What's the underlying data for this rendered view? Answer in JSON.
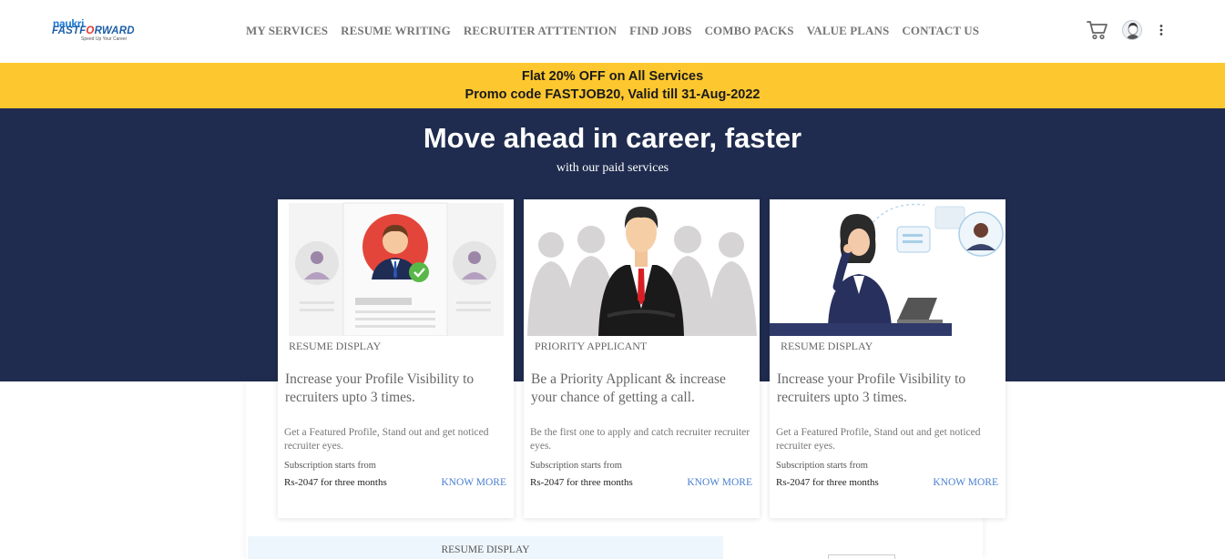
{
  "header": {
    "logo": {
      "line1": "naukri",
      "line2a": "FASTF",
      "line2b": "O",
      "line2c": "RWARD",
      "tagline": "Speed Up Your Career"
    },
    "nav": [
      "MY SERVICES",
      "RESUME WRITING",
      "RECRUITER ATTTENTION",
      "FIND JOBS",
      "COMBO PACKS",
      "VALUE PLANS",
      "CONTACT US"
    ],
    "icons": {
      "cart": "cart-icon",
      "avatar": "user-avatar-icon",
      "menu": "kebab-menu-icon"
    }
  },
  "promo": {
    "line1": "Flat 20% OFF on All Services",
    "line2": "Promo code FASTJOB20, Valid till 31-Aug-2022"
  },
  "hero": {
    "title": "Move ahead in career, faster",
    "subtitle": "with our paid services"
  },
  "cards": [
    {
      "tag": "RESUME DISPLAY",
      "headline": "Increase your Profile Visibility to recruiters upto 3 times.",
      "desc": "Get a Featured Profile, Stand out and get   noticed recruiter eyes.",
      "subs": "Subscription starts from",
      "price": "Rs-2047 for three months",
      "cta": "KNOW MORE"
    },
    {
      "tag": "PRIORITY APPLICANT",
      "headline": "Be a Priority Applicant & increase your chance of getting a call.",
      "desc": "Be the first one to apply and catch   recruiter recruiter eyes.",
      "subs": "Subscription starts from",
      "price": "Rs-2047 for three months",
      "cta": "KNOW MORE"
    },
    {
      "tag": "RESUME DISPLAY",
      "headline": "Increase your Profile Visibility to recruiters upto 3 times.",
      "desc": "Get a Featured Profile, Stand out and get   noticed recruiter eyes.",
      "subs": "Subscription starts from",
      "price": "Rs-2047 for three months",
      "cta": "KNOW MORE"
    }
  ],
  "bottom": {
    "tag": "RESUME DISPLAY"
  },
  "colors": {
    "promo_bg": "#fdc82f",
    "hero_bg": "#1f2c4f",
    "link": "#4a7fd1",
    "logo_blue": "#1d5fa8",
    "logo_red": "#e8342a"
  }
}
